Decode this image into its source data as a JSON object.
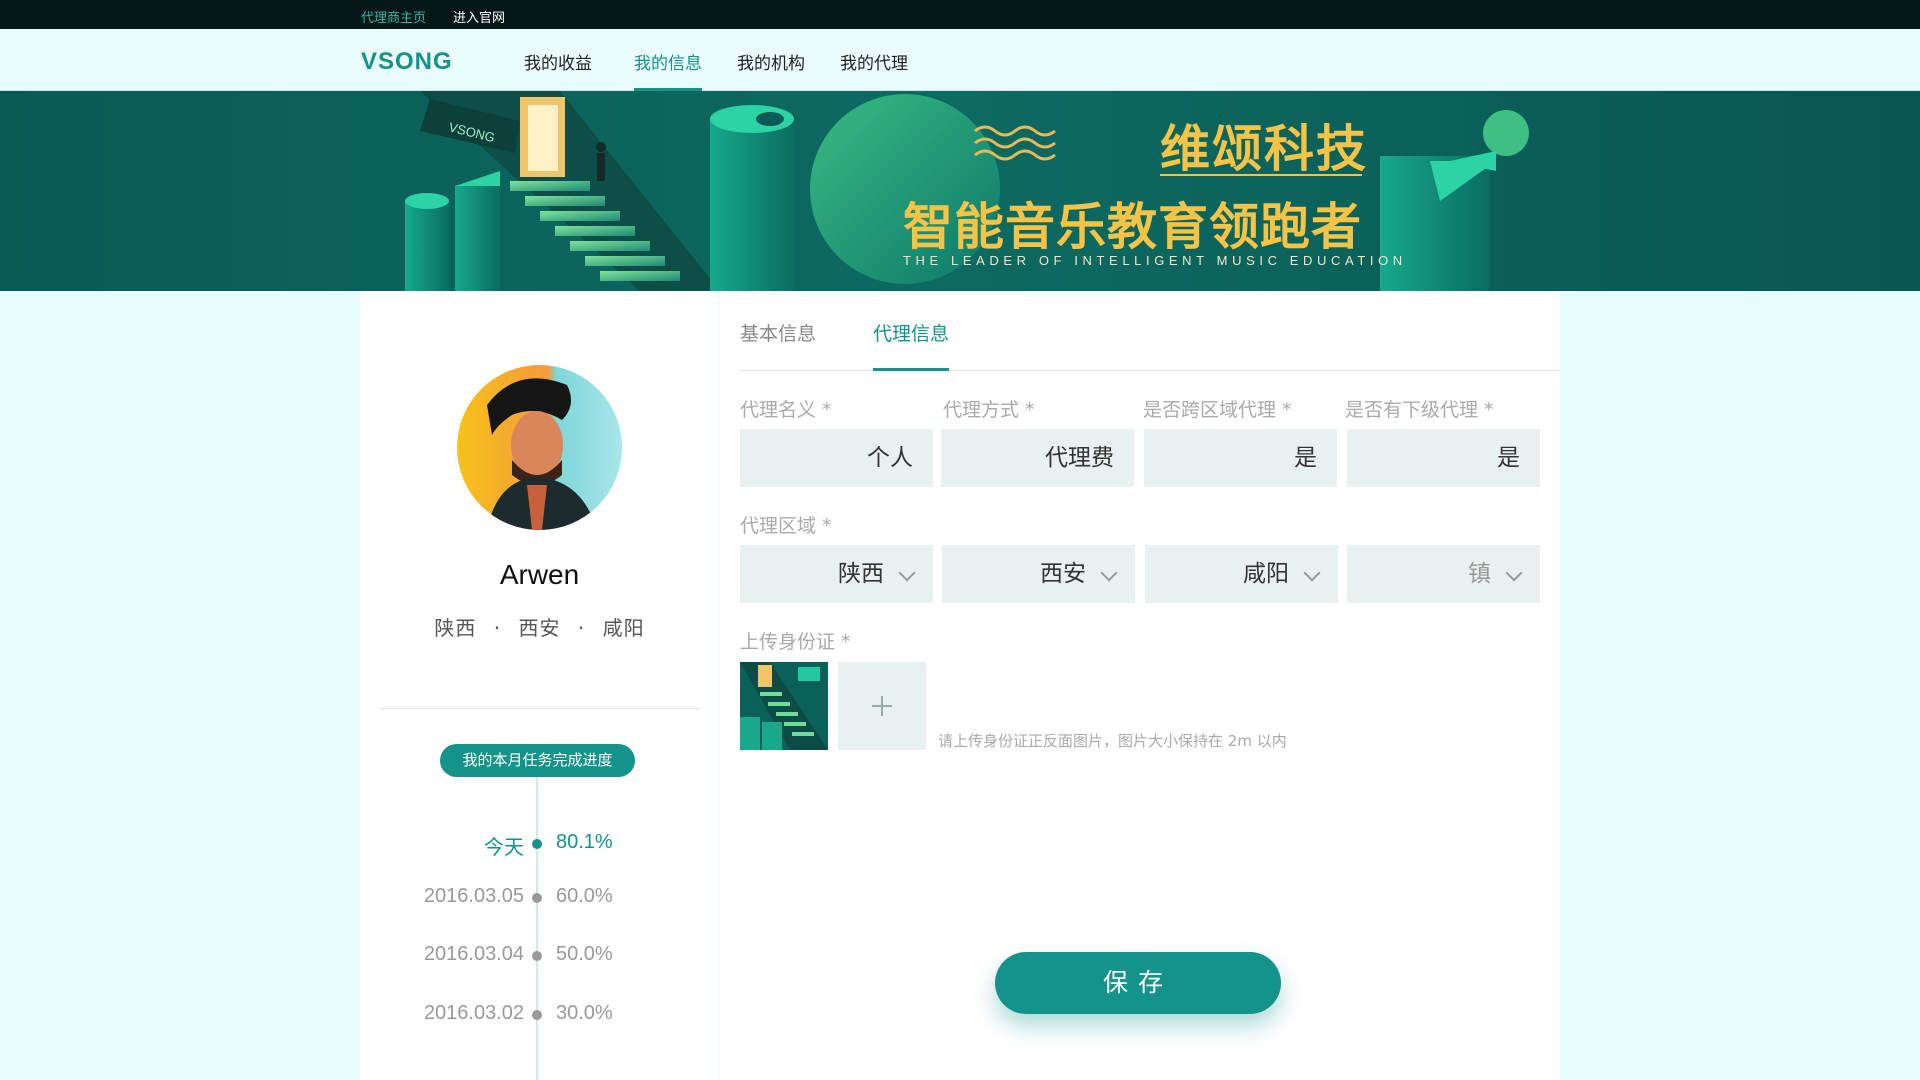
{
  "topbar": {
    "links": [
      "代理商主页",
      "进入官网"
    ]
  },
  "nav": {
    "logo_text": "VSONG",
    "items": [
      "我的收益",
      "我的信息",
      "我的机构",
      "我的代理"
    ],
    "active_index": 1
  },
  "banner": {
    "company": "维颂科技",
    "slogan_cn": "智能音乐教育领跑者",
    "slogan_en": "THE LEADER OF INTELLIGENT MUSIC EDUCATION",
    "sign_text": "VSONG"
  },
  "profile": {
    "name": "Arwen",
    "location": {
      "province": "陕西",
      "city": "西安",
      "district": "咸阳"
    },
    "separator": "·",
    "progress_title": "我的本月任务完成进度",
    "timeline": [
      {
        "date": "今天",
        "value": "80.1%",
        "current": true
      },
      {
        "date": "2016.03.05",
        "value": "60.0%",
        "current": false
      },
      {
        "date": "2016.03.04",
        "value": "50.0%",
        "current": false
      },
      {
        "date": "2016.03.02",
        "value": "30.0%",
        "current": false
      }
    ]
  },
  "form": {
    "tabs": [
      "基本信息",
      "代理信息"
    ],
    "active_tab": 1,
    "fields": [
      {
        "label": "代理名义 *",
        "value": "个人"
      },
      {
        "label": "代理方式 *",
        "value": "代理费"
      },
      {
        "label": "是否跨区域代理 *",
        "value": "是"
      },
      {
        "label": "是否有下级代理 *",
        "value": "是"
      }
    ],
    "region_label": "代理区域 *",
    "region_selects": [
      {
        "value": "陕西",
        "placeholder": false
      },
      {
        "value": "西安",
        "placeholder": false
      },
      {
        "value": "咸阳",
        "placeholder": false
      },
      {
        "value": "镇",
        "placeholder": true
      }
    ],
    "upload_label": "上传身份证 *",
    "upload_hint": "请上传身份证正反面图片，图片大小保持在 2m 以内",
    "save_label": "保存"
  },
  "colors": {
    "accent": "#13938a",
    "banner_bg": "#0a5a55",
    "banner_text": "#f6c347",
    "page_bg": "#e6fbfb",
    "topbar_bg": "#061718"
  },
  "icons": {
    "select_arrow": "chevron-down-icon",
    "upload_add": "plus-icon"
  }
}
